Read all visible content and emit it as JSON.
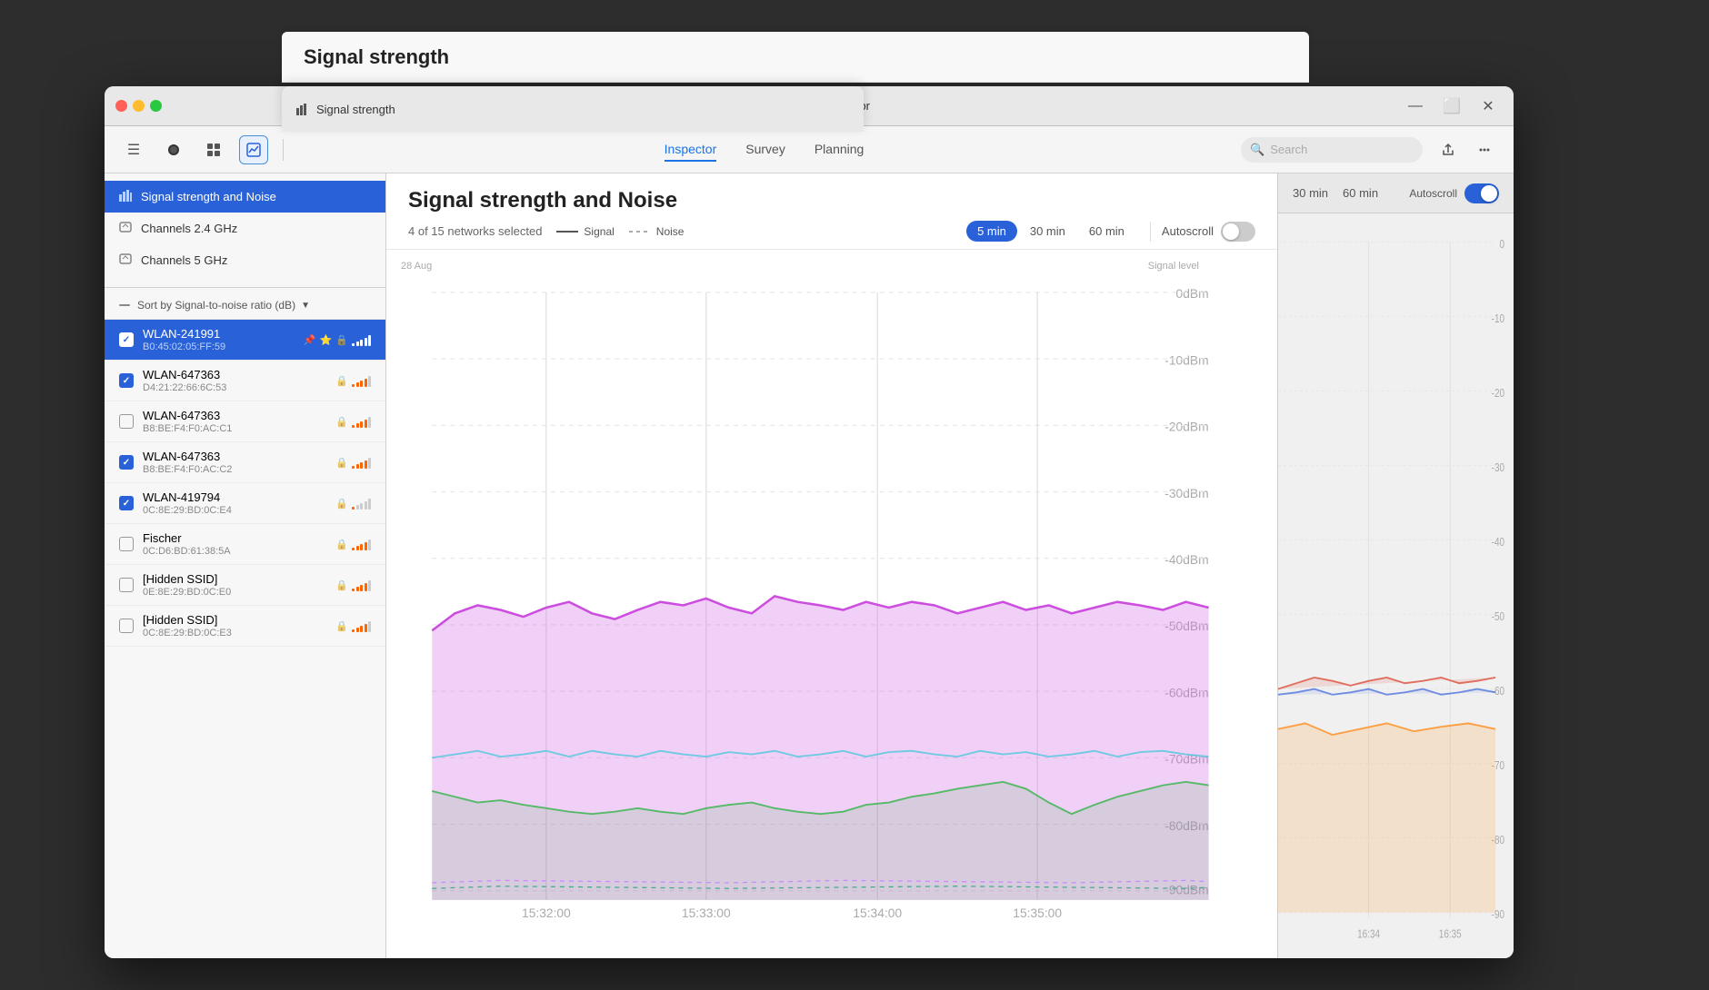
{
  "app": {
    "title": "NetSpot - Inspector",
    "icon": "📶"
  },
  "toolbar": {
    "nav_tabs": [
      "Inspector",
      "Survey",
      "Planning"
    ],
    "active_tab": "Inspector",
    "search_placeholder": "Search"
  },
  "sidebar": {
    "sections": [
      {
        "items": [
          {
            "id": "signal-strength-noise",
            "label": "Signal strength and Noise",
            "icon": "bar_chart"
          },
          {
            "id": "channels-24ghz",
            "label": "Channels 2.4 GHz",
            "icon": "router"
          },
          {
            "id": "channels-5ghz",
            "label": "Channels 5 GHz",
            "icon": "router"
          }
        ]
      }
    ],
    "sort_label": "Sort by Signal-to-noise ratio (dB)",
    "networks": [
      {
        "id": "wlan-241991",
        "name": "WLAN-241991",
        "mac": "B0:45:02:05:FF:59",
        "checked": true,
        "selected": true,
        "lock": true,
        "pin": true,
        "star": true,
        "signal_bars": 5
      },
      {
        "id": "wlan-647363-a",
        "name": "WLAN-647363",
        "mac": "D4:21:22:66:6C:53",
        "checked": true,
        "selected": false,
        "lock": true,
        "signal_bars": 4
      },
      {
        "id": "wlan-647363-b",
        "name": "WLAN-647363",
        "mac": "B8:BE:F4:F0:AC:C1",
        "checked": false,
        "selected": false,
        "lock": true,
        "signal_bars": 4
      },
      {
        "id": "wlan-647363-c",
        "name": "WLAN-647363",
        "mac": "B8:BE:F4:F0:AC:C2",
        "checked": true,
        "selected": false,
        "lock": true,
        "signal_bars": 4
      },
      {
        "id": "wlan-419794",
        "name": "WLAN-419794",
        "mac": "0C:8E:29:BD:0C:E4",
        "checked": true,
        "selected": false,
        "lock": true,
        "signal_bars": 2
      },
      {
        "id": "fischer",
        "name": "Fischer",
        "mac": "0C:D6:BD:61:38:5A",
        "checked": false,
        "selected": false,
        "lock": true,
        "signal_bars": 4
      },
      {
        "id": "hidden-ssid-a",
        "name": "[Hidden SSID]",
        "mac": "0E:8E:29:BD:0C:E0",
        "checked": false,
        "selected": false,
        "lock": true,
        "signal_bars": 4
      },
      {
        "id": "hidden-ssid-b",
        "name": "[Hidden SSID]",
        "mac": "0C:8E:29:BD:0C:E3",
        "checked": false,
        "selected": false,
        "lock": true,
        "signal_bars": 4
      }
    ]
  },
  "content": {
    "title": "Signal strength and Noise",
    "subtitle": "Signal strength",
    "networks_count": "4 of 15 networks selected",
    "legend": [
      {
        "label": "Signal",
        "type": "solid"
      },
      {
        "label": "Noise",
        "type": "dashed"
      }
    ],
    "time_buttons": [
      "5 min",
      "30 min",
      "60 min"
    ],
    "active_time": "5 min",
    "autoscroll_label": "Autoscroll",
    "time_labels": [
      "15:32:00",
      "15:33:00",
      "15:34:00",
      "15:35:00"
    ],
    "date_label": "28 Aug",
    "signal_level_label": "Signal level",
    "y_axis": [
      "0dBm",
      "-10dBm",
      "-20dBm",
      "-30dBm",
      "-40dBm",
      "-50dBm",
      "-60dBm",
      "-70dBm",
      "-80dBm",
      "-90dBm"
    ]
  },
  "right_panel": {
    "tabs": [
      "30 min",
      "60 min"
    ],
    "autoscroll_label": "Autoscroll",
    "time_labels": [
      "16:34",
      "16:35"
    ],
    "y_labels": [
      "0",
      "-10",
      "-20",
      "-30",
      "-40",
      "-50",
      "-60",
      "-70",
      "-80",
      "-90"
    ]
  }
}
